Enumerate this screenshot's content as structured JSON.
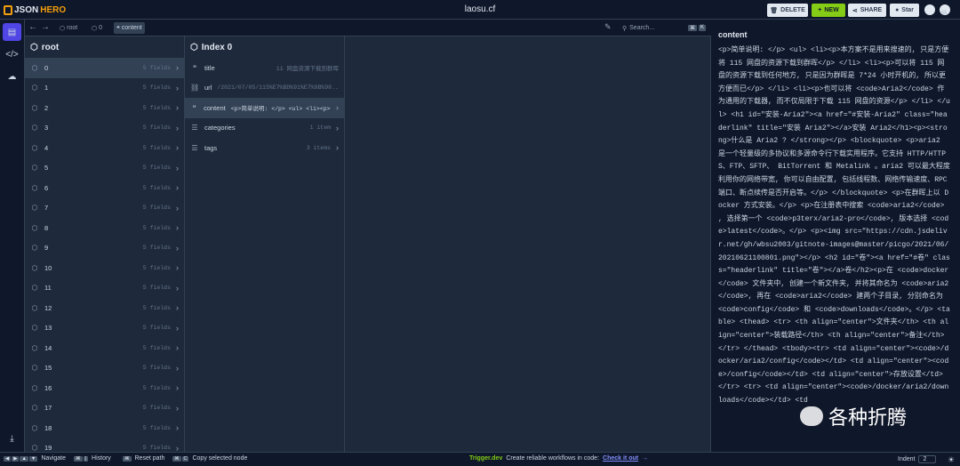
{
  "app": {
    "logo_text_1": "JSON",
    "logo_text_2": "HERO",
    "file_title": "laosu.cf"
  },
  "toolbar": {
    "delete_label": "DELETE",
    "new_label": "NEW",
    "share_label": "SHARE",
    "star_label": "Star"
  },
  "nav": {
    "breadcrumbs": [
      {
        "label": "root"
      },
      {
        "label": "0"
      },
      {
        "label": "content"
      }
    ],
    "search_placeholder": "Search...",
    "search_keys": [
      "⌘",
      "K"
    ]
  },
  "column1": {
    "title": "root",
    "rows": [
      {
        "key": "0",
        "value": "5 fields"
      },
      {
        "key": "1",
        "value": "5 fields"
      },
      {
        "key": "2",
        "value": "5 fields"
      },
      {
        "key": "3",
        "value": "5 fields"
      },
      {
        "key": "4",
        "value": "5 fields"
      },
      {
        "key": "5",
        "value": "5 fields"
      },
      {
        "key": "6",
        "value": "5 fields"
      },
      {
        "key": "7",
        "value": "5 fields"
      },
      {
        "key": "8",
        "value": "5 fields"
      },
      {
        "key": "9",
        "value": "5 fields"
      },
      {
        "key": "10",
        "value": "5 fields"
      },
      {
        "key": "11",
        "value": "5 fields"
      },
      {
        "key": "12",
        "value": "5 fields"
      },
      {
        "key": "13",
        "value": "5 fields"
      },
      {
        "key": "14",
        "value": "5 fields"
      },
      {
        "key": "15",
        "value": "5 fields"
      },
      {
        "key": "16",
        "value": "5 fields"
      },
      {
        "key": "17",
        "value": "5 fields"
      },
      {
        "key": "18",
        "value": "5 fields"
      },
      {
        "key": "19",
        "value": "5 fields"
      }
    ]
  },
  "column2": {
    "title": "Index 0",
    "rows": [
      {
        "key": "title",
        "value": "11 网盘资源下载到群晖"
      },
      {
        "key": "url",
        "value": "/2021/07/05/115%E7%BD%91%E7%9B%98..."
      },
      {
        "key": "content",
        "value": "<p>简单说明: </p> <ul> <li><p>..."
      },
      {
        "key": "categories",
        "value": "1 item"
      },
      {
        "key": "tags",
        "value": "3 items"
      }
    ]
  },
  "panel": {
    "title": "content",
    "body": "<p>简单说明: </p> <ul> <li><p>本方案不是用来搜速的, 只是方便将 115 网盘的资源下载到群晖</p> </li> <li><p>可以将 115 网盘的资源下载到任何地方, 只是因为群晖是 7*24 小时开机的, 所以更方便而已</p> </li> <li><p>也可以将 <code>Aria2</code> 作为通用的下载器, 而不仅局限于下载 115 网盘的资源</p> </li> </ul> <h1 id=\"安装-Aria2\"><a href=\"#安装-Aria2\" class=\"headerlink\" title=\"安装 Aria2\"></a>安装 Aria2</h1><p><strong>什么是 Aria2 ? </strong></p> <blockquote> <p>aria2 是一个轻量级的多协议和多源命令行下载实用程序。它支持 HTTP/HTTPS、FTP、SFTP、 BitTorrent 和 Metalink 。aria2 可以最大程度利用你的网络带宽, 你可以自由配置, 包括线程数、网络传输速度、RPC 端口、断点续传是否开启等。</p> </blockquote> <p>在群晖上以 Docker 方式安装。</p> <p>在注册表中搜索 <code>aria2</code> , 选择第一个 <code>p3terx/aria2-pro</code>, 版本选择 <code>latest</code>。</p> <p><img src=\"https://cdn.jsdelivr.net/gh/wbsu2003/gitnote-images@master/picgo/2021/06/20210621100801.png\"></p> <h2 id=\"卷\"><a href=\"#卷\" class=\"headerlink\" title=\"卷\"></a>卷</h2><p>在 <code>docker</code> 文件夹中, 创建一个新文件夹, 并将其命名为 <code>aria2</code>, 再在 <code>aria2</code> 建两个子目录, 分别命名为 <code>config</code> 和 <code>downloads</code>。</p> <table> <thead> <tr> <th align=\"center\">文件夹</th> <th align=\"center\">装载路径</th> <th align=\"center\">备注</th> </tr> </thead> <tbody><tr> <td align=\"center\"><code>/docker/aria2/config</code></td> <td align=\"center\"><code>/config</code></td> <td align=\"center\">存放设置</td> </tr> <tr> <td align=\"center\"><code>/docker/aria2/downloads</code></td> <td"
  },
  "watermark": {
    "text": "各种折腾"
  },
  "statusbar": {
    "navigate_keys": [
      "◀",
      "▶",
      "▲",
      "▼"
    ],
    "navigate_label": "Navigate",
    "history_keys": [
      "⌘",
      "["
    ],
    "history_label": "History",
    "reset_keys": [
      "⌘"
    ],
    "reset_label": "Reset path",
    "copy_keys": [
      "⌘",
      "C"
    ],
    "copy_label": "Copy selected node",
    "trigger_brand": "Trigger.dev",
    "trigger_text": "Create reliable workflows in code:",
    "trigger_link": "Check it out",
    "indent_label": "Indent",
    "indent_value": "2"
  },
  "colors": {
    "accent": "#4f46e5",
    "new_button": "#84cc16",
    "logo": "#f59e0b",
    "background": "#1e293b"
  }
}
